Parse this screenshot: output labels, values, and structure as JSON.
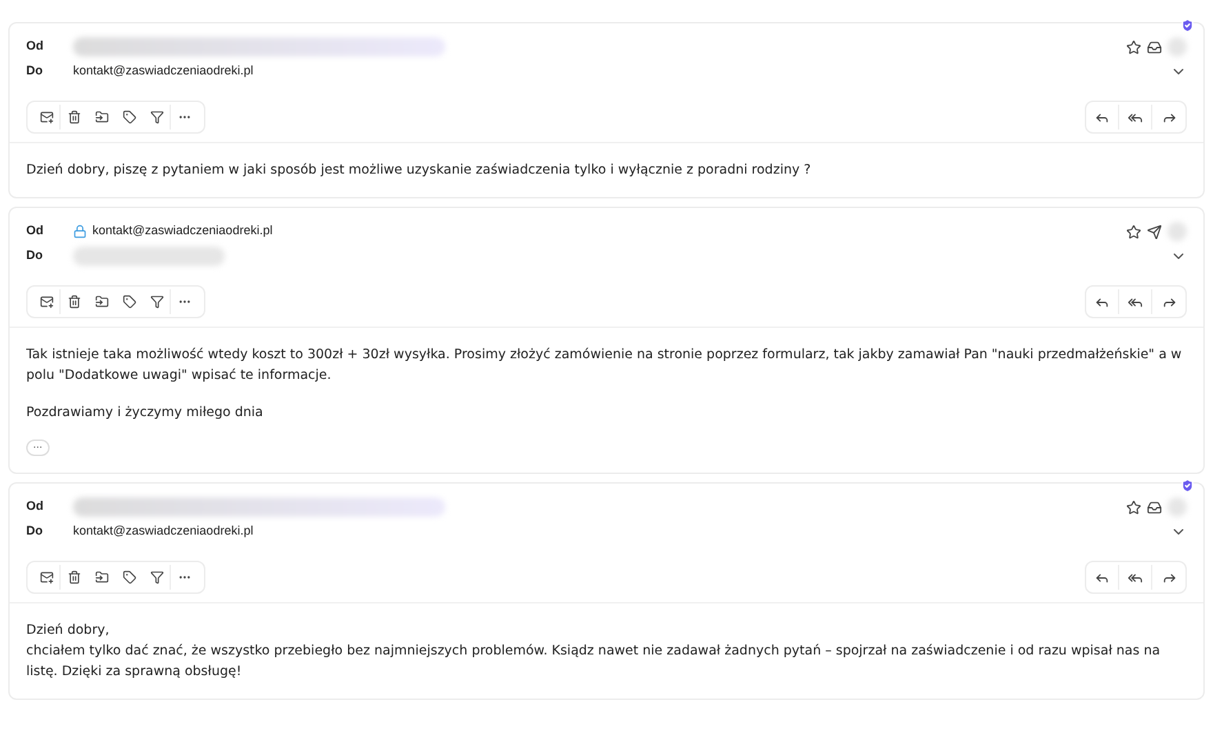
{
  "messages": [
    {
      "verified": true,
      "from_label": "Od",
      "from": {
        "kind": "redacted"
      },
      "to_label": "Do",
      "to": {
        "kind": "address",
        "text": "kontakt@zaswiadczeniaodreki.pl",
        "locked": false
      },
      "status_icon": {
        "kind": "inbox"
      },
      "body": [
        "Dzień dobry, piszę z pytaniem w jaki sposób jest możliwe uzyskanie zaświadczenia tylko i wyłącznie z poradni rodziny ?"
      ]
    },
    {
      "verified": false,
      "from_label": "Od",
      "from": {
        "kind": "address",
        "text": "kontakt@zaswiadczeniaodreki.pl",
        "locked": true
      },
      "to_label": "Do",
      "to": {
        "kind": "redacted"
      },
      "status_icon": {
        "kind": "sent"
      },
      "body": [
        "Tak istnieje taka możliwość wtedy koszt to 300zł + 30zł wysyłka. Prosimy złożyć zamówienie na stronie poprzez formularz, tak jakby zamawiał Pan \"nauki przedmałżeńskie\" a w polu \"Dodatkowe uwagi\" wpisać te informacje.",
        "Pozdrawiamy i życzymy miłego dnia"
      ],
      "more": "···"
    },
    {
      "verified": true,
      "from_label": "Od",
      "from": {
        "kind": "redacted"
      },
      "to_label": "Do",
      "to": {
        "kind": "address",
        "text": "kontakt@zaswiadczeniaodreki.pl",
        "locked": false
      },
      "status_icon": {
        "kind": "inbox"
      },
      "body": [
        "Dzień dobry,\nchciałem tylko dać znać, że wszystko przebiegło bez najmniejszych problemów. Ksiądz nawet nie zadawał żadnych pytań – spojrzał na zaświadczenie i od razu wpisał nas na listę. Dzięki za sprawną obsługę!"
      ]
    }
  ]
}
